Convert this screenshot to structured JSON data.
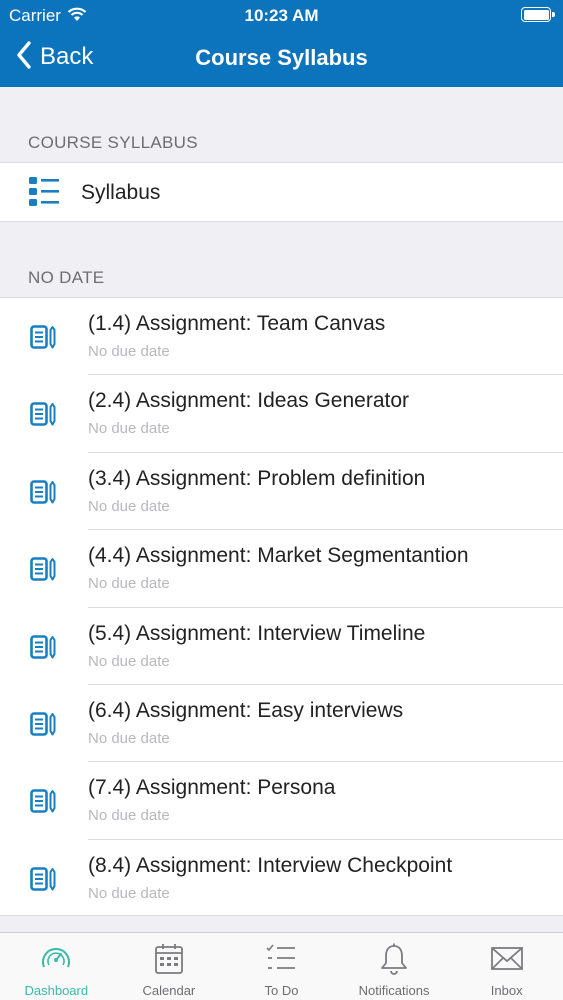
{
  "status_bar": {
    "carrier": "Carrier",
    "time": "10:23 AM"
  },
  "nav": {
    "back_label": "Back",
    "title": "Course Syllabus"
  },
  "sections": {
    "syllabus_header": "COURSE SYLLABUS",
    "syllabus_item": "Syllabus",
    "no_date_header": "NO DATE"
  },
  "assignments": [
    {
      "title": "(1.4) Assignment: Team Canvas",
      "due": "No due date"
    },
    {
      "title": "(2.4) Assignment: Ideas Generator",
      "due": "No due date"
    },
    {
      "title": "(3.4) Assignment: Problem definition",
      "due": "No due date"
    },
    {
      "title": "(4.4) Assignment: Market Segmentantion",
      "due": "No due date"
    },
    {
      "title": "(5.4) Assignment: Interview Timeline",
      "due": "No due date"
    },
    {
      "title": "(6.4) Assignment: Easy interviews",
      "due": "No due date"
    },
    {
      "title": "(7.4) Assignment: Persona",
      "due": "No due date"
    },
    {
      "title": "(8.4) Assignment: Interview Checkpoint",
      "due": "No due date"
    }
  ],
  "tabbar": [
    {
      "label": "Dashboard",
      "icon": "dashboard-icon",
      "active": true
    },
    {
      "label": "Calendar",
      "icon": "calendar-icon",
      "active": false
    },
    {
      "label": "To Do",
      "icon": "todo-icon",
      "active": false
    },
    {
      "label": "Notifications",
      "icon": "bell-icon",
      "active": false
    },
    {
      "label": "Inbox",
      "icon": "envelope-icon",
      "active": false
    }
  ],
  "colors": {
    "brand": "#0b74bd",
    "active_tab": "#3cb9a8",
    "icon_blue": "#1a7fc1"
  }
}
